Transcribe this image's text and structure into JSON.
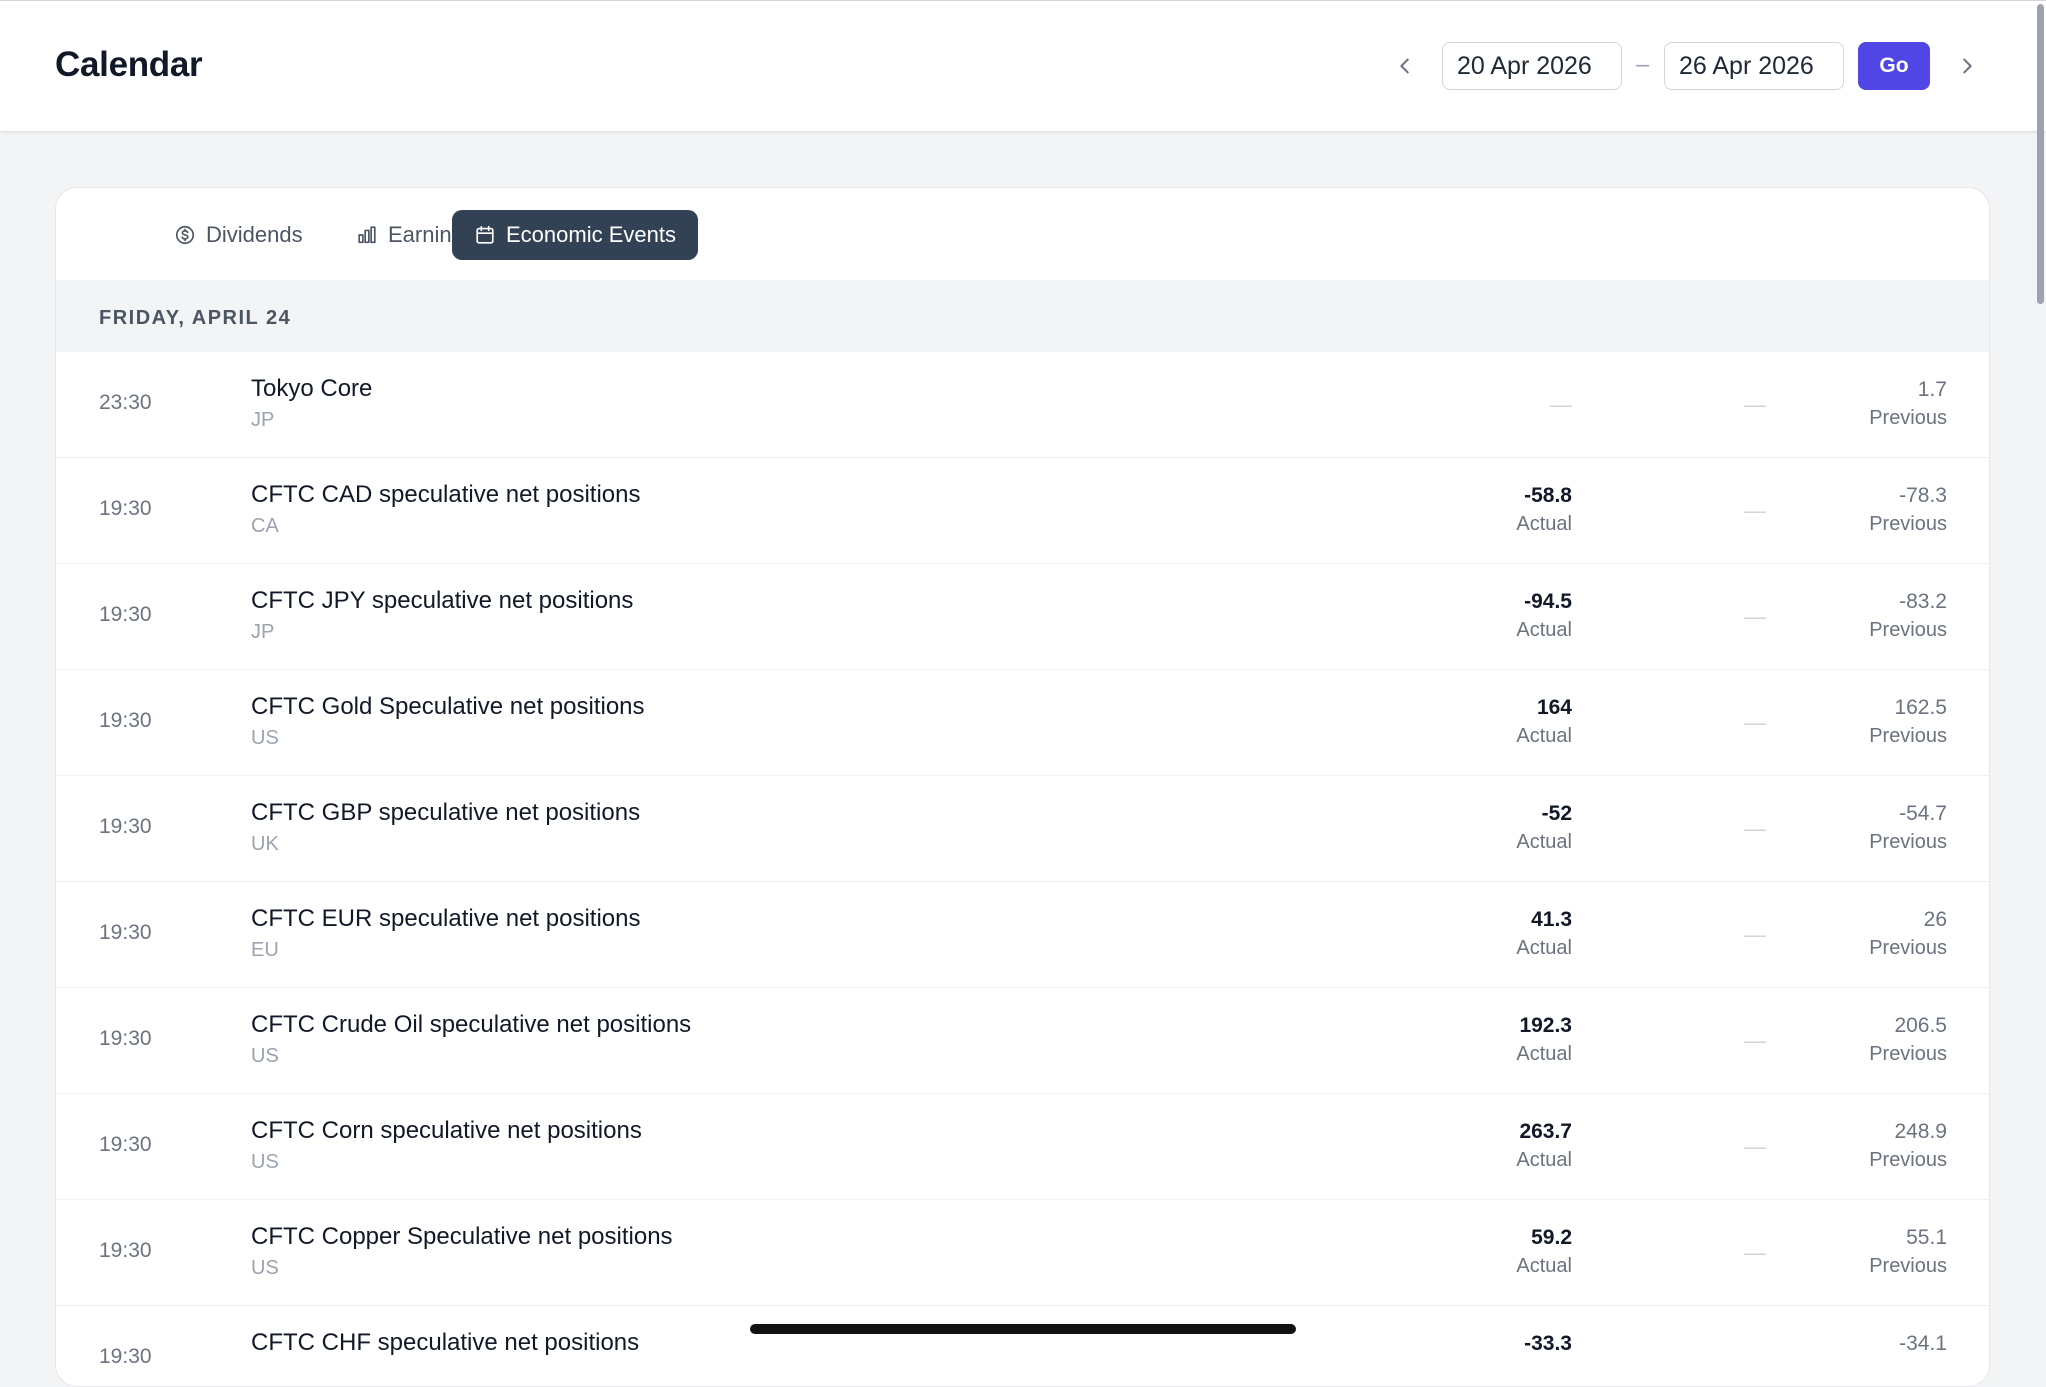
{
  "header": {
    "title": "Calendar",
    "start_date": "20 Apr 2026",
    "date_separator": "–",
    "end_date": "26 Apr 2026",
    "go_label": "Go"
  },
  "tabs": [
    {
      "label": "Dividends",
      "icon": "dollar-circle-icon",
      "active": false
    },
    {
      "label": "Earnings",
      "icon": "bar-chart-icon",
      "active": false
    },
    {
      "label": "Economic Events",
      "icon": "calendar-icon",
      "active": true
    }
  ],
  "day_header": "FRIDAY, APRIL 24",
  "events": [
    {
      "time": "23:30",
      "name": "Tokyo Core",
      "country": "JP",
      "actual": "—",
      "actual_label": "",
      "forecast": "—",
      "previous": "1.7",
      "previous_label": "Previous"
    },
    {
      "time": "19:30",
      "name": "CFTC CAD speculative net positions",
      "country": "CA",
      "actual": "-58.8",
      "actual_label": "Actual",
      "forecast": "—",
      "previous": "-78.3",
      "previous_label": "Previous"
    },
    {
      "time": "19:30",
      "name": "CFTC JPY speculative net positions",
      "country": "JP",
      "actual": "-94.5",
      "actual_label": "Actual",
      "forecast": "—",
      "previous": "-83.2",
      "previous_label": "Previous"
    },
    {
      "time": "19:30",
      "name": "CFTC Gold Speculative net positions",
      "country": "US",
      "actual": "164",
      "actual_label": "Actual",
      "forecast": "—",
      "previous": "162.5",
      "previous_label": "Previous"
    },
    {
      "time": "19:30",
      "name": "CFTC GBP speculative net positions",
      "country": "UK",
      "actual": "-52",
      "actual_label": "Actual",
      "forecast": "—",
      "previous": "-54.7",
      "previous_label": "Previous"
    },
    {
      "time": "19:30",
      "name": "CFTC EUR speculative net positions",
      "country": "EU",
      "actual": "41.3",
      "actual_label": "Actual",
      "forecast": "—",
      "previous": "26",
      "previous_label": "Previous"
    },
    {
      "time": "19:30",
      "name": "CFTC Crude Oil speculative net positions",
      "country": "US",
      "actual": "192.3",
      "actual_label": "Actual",
      "forecast": "—",
      "previous": "206.5",
      "previous_label": "Previous"
    },
    {
      "time": "19:30",
      "name": "CFTC Corn speculative net positions",
      "country": "US",
      "actual": "263.7",
      "actual_label": "Actual",
      "forecast": "—",
      "previous": "248.9",
      "previous_label": "Previous"
    },
    {
      "time": "19:30",
      "name": "CFTC Copper Speculative net positions",
      "country": "US",
      "actual": "59.2",
      "actual_label": "Actual",
      "forecast": "—",
      "previous": "55.1",
      "previous_label": "Previous"
    },
    {
      "time": "19:30",
      "name": "CFTC CHF speculative net positions",
      "country": "",
      "actual": "-33.3",
      "actual_label": "",
      "forecast": "",
      "previous": "-34.1",
      "previous_label": ""
    }
  ],
  "colors": {
    "accent": "#4f46e5",
    "active_tab": "#334155",
    "background": "#f3f4f6"
  }
}
